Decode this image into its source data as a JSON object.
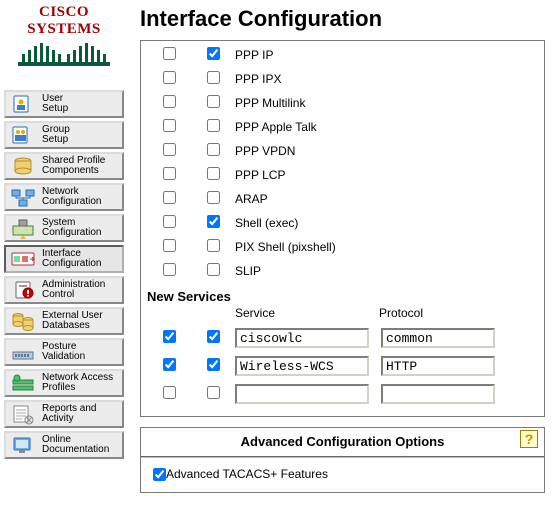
{
  "brand": "CISCO SYSTEMS",
  "page_title": "Interface Configuration",
  "sidebar": {
    "items": [
      {
        "label": "User\nSetup"
      },
      {
        "label": "Group\nSetup"
      },
      {
        "label": "Shared Profile\nComponents"
      },
      {
        "label": "Network\nConfiguration"
      },
      {
        "label": "System\nConfiguration"
      },
      {
        "label": "Interface\nConfiguration",
        "active": true
      },
      {
        "label": "Administration\nControl"
      },
      {
        "label": "External User\nDatabases"
      },
      {
        "label": "Posture\nValidation"
      },
      {
        "label": "Network Access\nProfiles"
      },
      {
        "label": "Reports and\nActivity"
      },
      {
        "label": "Online\nDocumentation"
      }
    ]
  },
  "services": [
    {
      "a": false,
      "b": true,
      "label": "PPP IP"
    },
    {
      "a": false,
      "b": false,
      "label": "PPP IPX"
    },
    {
      "a": false,
      "b": false,
      "label": "PPP Multilink"
    },
    {
      "a": false,
      "b": false,
      "label": "PPP Apple Talk"
    },
    {
      "a": false,
      "b": false,
      "label": "PPP VPDN"
    },
    {
      "a": false,
      "b": false,
      "label": "PPP LCP"
    },
    {
      "a": false,
      "b": false,
      "label": "ARAP"
    },
    {
      "a": false,
      "b": true,
      "label": "Shell (exec)"
    },
    {
      "a": false,
      "b": false,
      "label": "PIX Shell (pixshell)"
    },
    {
      "a": false,
      "b": false,
      "label": "SLIP"
    }
  ],
  "new_services": {
    "title": "New Services",
    "head_service": "Service",
    "head_protocol": "Protocol",
    "rows": [
      {
        "a": true,
        "b": true,
        "service": "ciscowlc",
        "protocol": "common"
      },
      {
        "a": true,
        "b": true,
        "service": "Wireless-WCS",
        "protocol": "HTTP"
      },
      {
        "a": false,
        "b": false,
        "service": "",
        "protocol": ""
      }
    ]
  },
  "advanced": {
    "title": "Advanced Configuration Options",
    "items": [
      {
        "checked": true,
        "label": "Advanced TACACS+ Features"
      }
    ]
  }
}
